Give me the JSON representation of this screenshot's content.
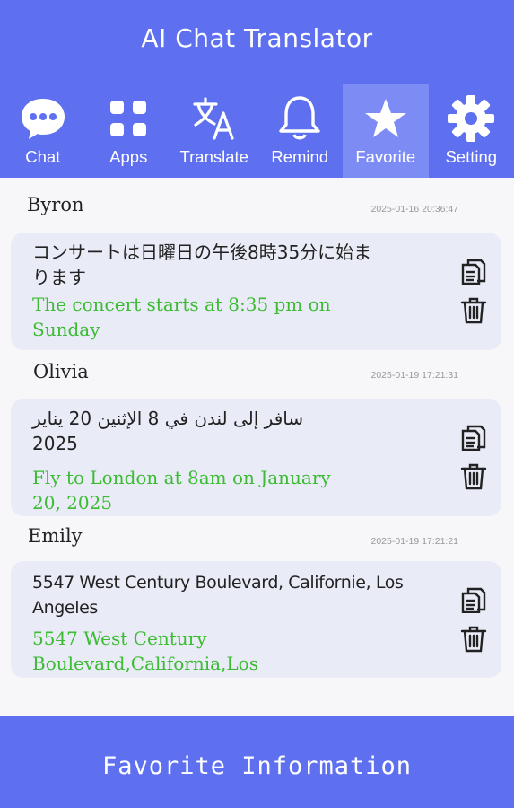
{
  "app": {
    "title": "AI Chat Translator"
  },
  "tabs": [
    {
      "label": "Chat",
      "icon": "chat-bubble-icon"
    },
    {
      "label": "Apps",
      "icon": "apps-grid-icon"
    },
    {
      "label": "Translate",
      "icon": "translate-icon"
    },
    {
      "label": "Remind",
      "icon": "bell-icon"
    },
    {
      "label": "Favorite",
      "icon": "star-icon",
      "active": true
    },
    {
      "label": "Setting",
      "icon": "gear-icon"
    }
  ],
  "favorites": [
    {
      "name": "Byron",
      "timestamp": "2025-01-16 20:36:47",
      "source_lines": [
        "コンサートは日曜日の午後8時35分に始ま",
        "ります"
      ],
      "translation_lines": [
        "The concert starts at 8:35 pm on",
        "Sunday"
      ]
    },
    {
      "name": "Olivia",
      "timestamp": "2025-01-19 17:21:31",
      "source_lines": [
        "سافر إلى لندن في 8 الإثنين 20 يناير",
        "2025"
      ],
      "translation_lines": [
        "Fly to London at 8am on January",
        "20, 2025"
      ]
    },
    {
      "name": "Emily",
      "timestamp": "2025-01-19 17:21:21",
      "source_lines": [
        "5547 West Century Boulevard, Californie, Los",
        "Angeles"
      ],
      "translation_lines": [
        "5547 West Century",
        "Boulevard,California,Los"
      ]
    }
  ],
  "footer": {
    "title": "Favorite Information"
  },
  "colors": {
    "primary": "#5e70f0",
    "active_tab": "#7d8cf4",
    "card": "#e9ebf7",
    "translation": "#3cbb33"
  }
}
